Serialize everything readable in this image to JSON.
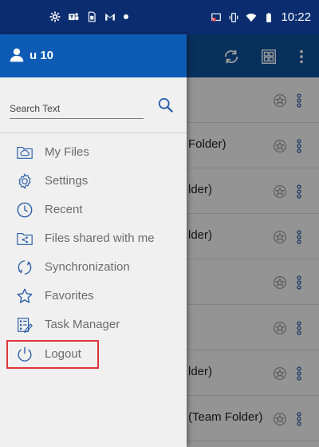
{
  "status_bar": {
    "time": "10:22",
    "left_icons": [
      "gear-icon",
      "teams-icon",
      "sim-icon",
      "gmail-icon",
      "dot-icon"
    ],
    "right_icons": [
      "cast-icon",
      "vibrate-icon",
      "wifi-icon",
      "battery-icon"
    ]
  },
  "toolbar": {
    "icons": [
      "sync-icon",
      "grid-view-icon",
      "more-vert-icon"
    ]
  },
  "drawer": {
    "user": {
      "name": "u 10"
    },
    "search": {
      "placeholder": "Search Text"
    },
    "menu": [
      {
        "label": "My Files",
        "icon": "cloud-folder-icon"
      },
      {
        "label": "Settings",
        "icon": "settings-gear-icon"
      },
      {
        "label": "Recent",
        "icon": "clock-icon"
      },
      {
        "label": "Files shared with me",
        "icon": "shared-folder-icon"
      },
      {
        "label": "Synchronization",
        "icon": "sync-icon"
      },
      {
        "label": "Favorites",
        "icon": "star-icon"
      },
      {
        "label": "Task Manager",
        "icon": "task-manager-icon"
      },
      {
        "label": "Logout",
        "icon": "power-icon"
      }
    ]
  },
  "background_list": {
    "rows": [
      {
        "text": ""
      },
      {
        "text": "Folder)"
      },
      {
        "text": "lder)"
      },
      {
        "text": "lder)"
      },
      {
        "text": ""
      },
      {
        "text": ""
      },
      {
        "text": "lder)"
      },
      {
        "text": "(Team Folder)"
      }
    ]
  },
  "colors": {
    "status_bar": "#0b2d70",
    "drawer_header": "#0d5bb5",
    "icon_blue": "#2a5ea8",
    "highlight": "#e0363b"
  }
}
